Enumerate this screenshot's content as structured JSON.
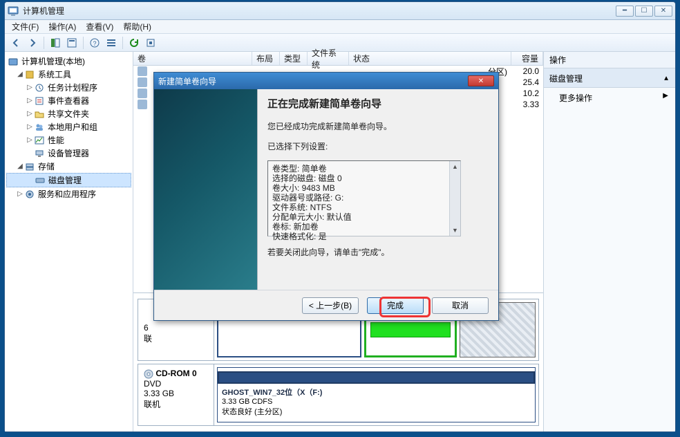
{
  "window": {
    "title": "计算机管理"
  },
  "menu": {
    "file": "文件(F)",
    "action": "操作(A)",
    "view": "查看(V)",
    "help": "帮助(H)"
  },
  "tree": {
    "root": "计算机管理(本地)",
    "system_tools": "系统工具",
    "task_scheduler": "任务计划程序",
    "event_viewer": "事件查看器",
    "shared_folders": "共享文件夹",
    "local_users": "本地用户和组",
    "performance": "性能",
    "device_manager": "设备管理器",
    "storage": "存储",
    "disk_management": "磁盘管理",
    "services_apps": "服务和应用程序"
  },
  "list_headers": {
    "volume": "卷",
    "layout": "布局",
    "type": "类型",
    "filesystem": "文件系统",
    "status": "状态",
    "capacity": "容量"
  },
  "list_rows": [
    {
      "status_suffix": "分区)",
      "capacity": "20.0"
    },
    {
      "status_suffix": "",
      "capacity": "25.4"
    },
    {
      "status_suffix": "",
      "capacity": "10.2"
    },
    {
      "status_suffix": "",
      "capacity": "3.33"
    }
  ],
  "disk": {
    "cdrom_label": "CD-ROM 0",
    "cdrom_type": "DVD",
    "cdrom_size": "3.33 GB",
    "cdrom_state": "联机",
    "part_title": "GHOST_WIN7_32位（X（F:)",
    "part_line2": "3.33 GB CDFS",
    "part_line3": "状态良好 (主分区)"
  },
  "actions": {
    "header": "操作",
    "section": "磁盘管理",
    "more": "更多操作"
  },
  "dialog": {
    "title": "新建简单卷向导",
    "heading": "正在完成新建简单卷向导",
    "success_msg": "您已经成功完成新建简单卷向导。",
    "selected_label": "已选择下列设置:",
    "settings_text": "卷类型: 简单卷\n选择的磁盘: 磁盘 0\n卷大小: 9483 MB\n驱动器号或路径: G:\n文件系统: NTFS\n分配单元大小: 默认值\n卷标: 新加卷\n快速格式化: 是",
    "close_hint": "若要关闭此向导，请单击\"完成\"。",
    "back_btn": "< 上一步(B)",
    "finish_btn": "完成",
    "cancel_btn": "取消"
  }
}
